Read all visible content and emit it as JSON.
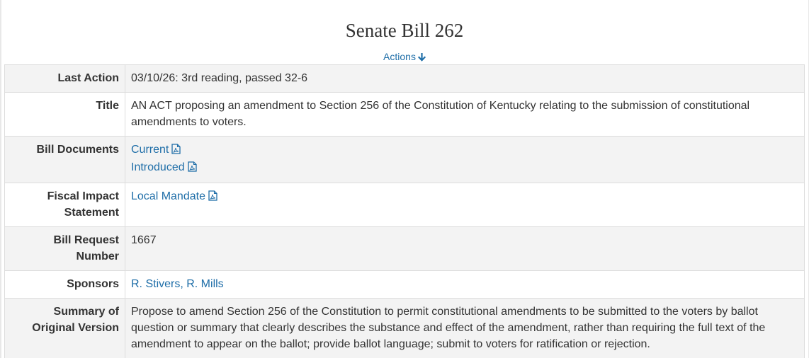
{
  "header": {
    "title": "Senate Bill 262",
    "actions_label": "Actions"
  },
  "rows": {
    "last_action": {
      "label": "Last Action",
      "value": "03/10/26: 3rd reading, passed 32-6"
    },
    "title": {
      "label": "Title",
      "value": "AN ACT proposing an amendment to Section 256 of the Constitution of Kentucky relating to the submission of constitutional amendments to voters."
    },
    "bill_documents": {
      "label": "Bill Documents",
      "items": [
        {
          "label": "Current",
          "icon": "pdf-icon"
        },
        {
          "label": "Introduced",
          "icon": "pdf-icon"
        }
      ]
    },
    "fiscal_impact": {
      "label": "Fiscal Impact Statement",
      "link": "Local Mandate",
      "icon": "pdf-icon"
    },
    "bill_request": {
      "label": "Bill Request Number",
      "value": "1667"
    },
    "sponsors": {
      "label": "Sponsors",
      "value": "R. Stivers, R. Mills"
    },
    "summary": {
      "label": "Summary of Original Version",
      "value": "Propose to amend Section 256 of the Constitution to permit constitutional amendments to be submitted to the voters by ballot question or summary that clearly describes the substance and effect of the amendment, rather than requiring the full text of the amendment to appear on the ballot; provide ballot language; submit to voters for ratification or rejection."
    }
  },
  "colors": {
    "link": "#1f6ea8",
    "text": "#333333",
    "row_shaded": "#f3f3f3",
    "border": "#dddddd"
  }
}
